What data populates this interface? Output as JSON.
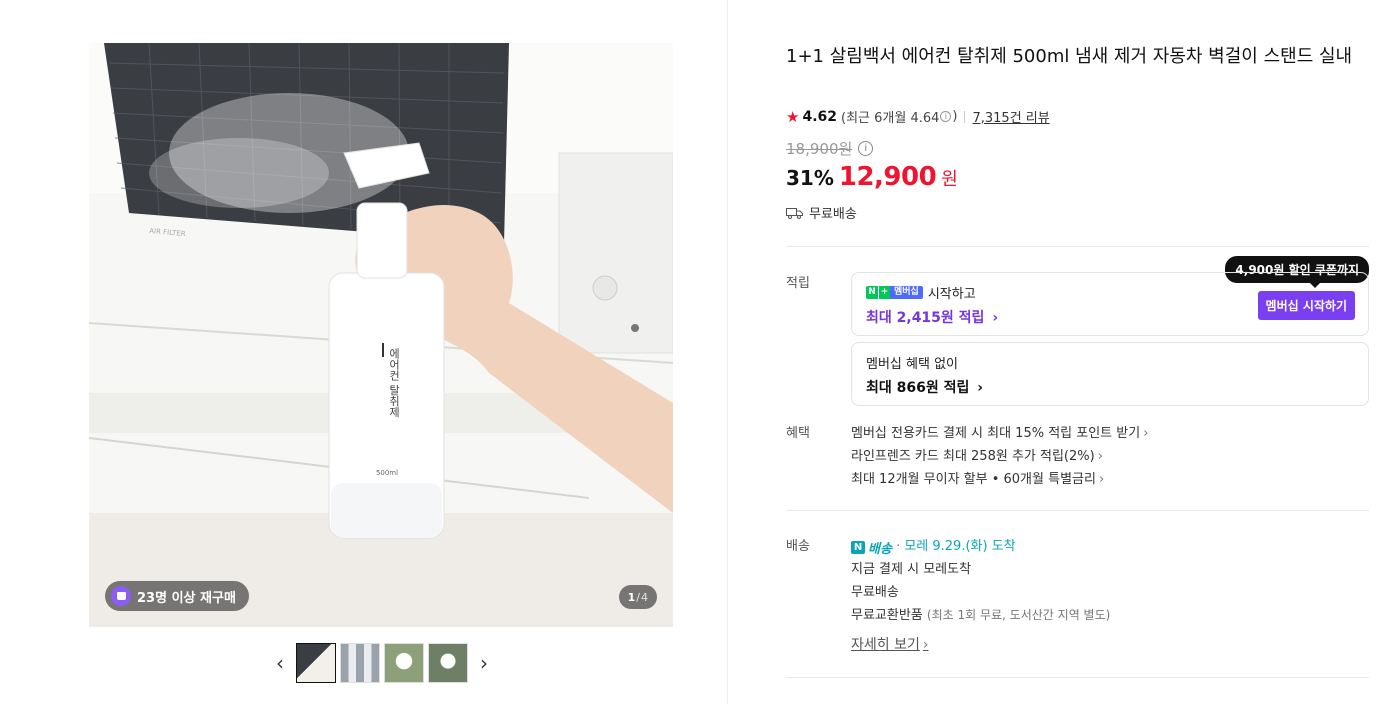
{
  "gallery": {
    "repurchase_badge": "23명 이상 재구매",
    "counter_current": "1",
    "counter_total": "4",
    "prev_label": "‹",
    "next_label": "›",
    "bottle_label_main": "에어컨 탈취제",
    "bottle_label_sub": "500ml",
    "filter_text": "AIR FILTER"
  },
  "product": {
    "title": "1+1 살림백서 에어컨 탈취제 500ml 냄새 제거 자동차 벽걸이 스탠드 실내",
    "rating": "4.62",
    "recent_rating": "(최근 6개월 4.64",
    "recent_rating_close": ")",
    "review_count": "7,315건 리뷰",
    "original_price": "18,900원",
    "discount": "31%",
    "price": "12,900",
    "currency": "원",
    "shipping": "무료배송"
  },
  "points": {
    "label": "적립",
    "tooltip": "4,900원 할인 쿠폰까지",
    "member_badge": "멤버십",
    "member_start": "시작하고",
    "member_max": "최대 2,415원 적립",
    "member_button": "멤버십 시작하기",
    "nonmember_title": "멤버십 혜택 없이",
    "nonmember_max": "최대 866원 적립"
  },
  "benefits": {
    "label": "혜택",
    "items": [
      "멤버십 전용카드 결제 시 최대 15% 적립 포인트 받기",
      "라인프렌즈 카드 최대 258원 추가 적립(2%)",
      "최대 12개월 무이자 할부 • 60개월 특별금리"
    ]
  },
  "delivery": {
    "label": "배송",
    "brand": "배송",
    "arrival": "모레 9.29.(화) 도착",
    "line1": "지금 결제 시 모레도착",
    "line2": "무료배송",
    "line3_main": "무료교환반품",
    "line3_note": "(최초 1회 무료, 도서산간 지역 별도)",
    "detail_link": "자세히 보기"
  }
}
